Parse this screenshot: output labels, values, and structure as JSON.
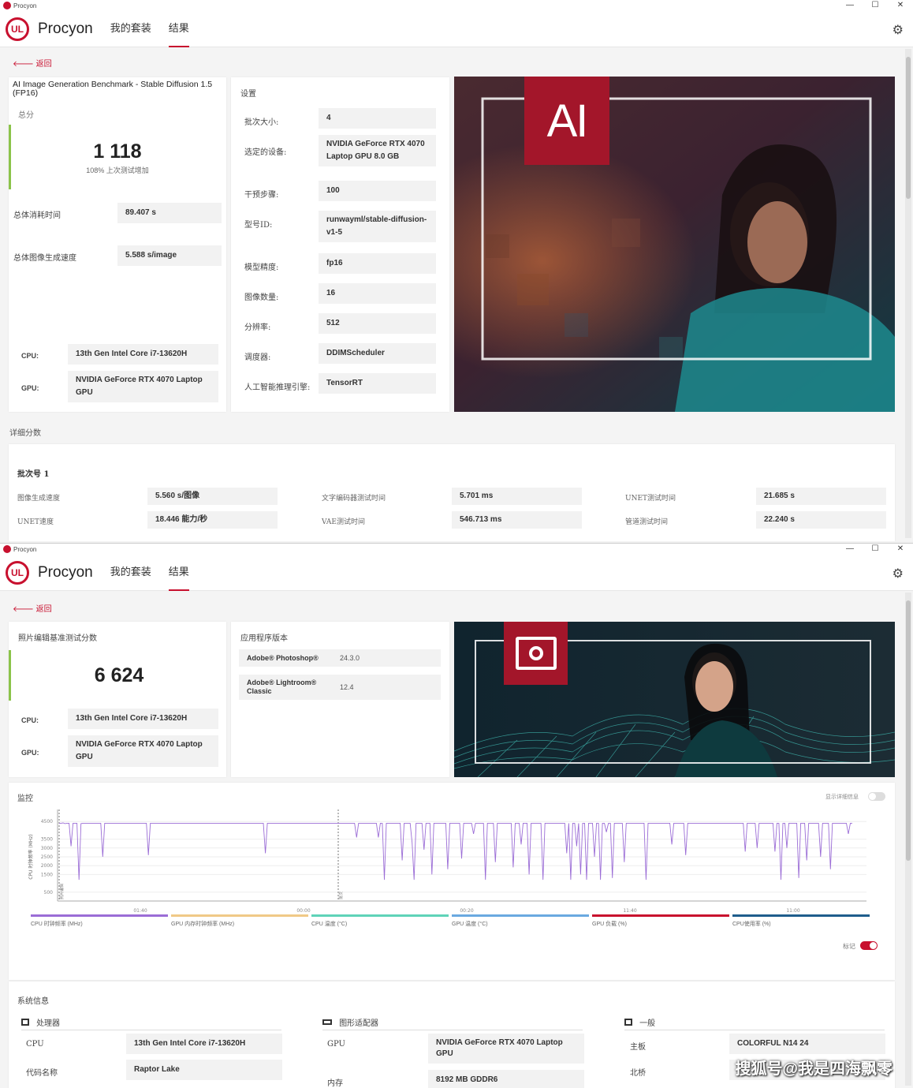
{
  "colors": {
    "brand": "#c8102e",
    "score_bar": "#8bc34a",
    "chart_line": "#9b6dd6"
  },
  "window1": {
    "title": "Procyon",
    "app_name": "Procyon",
    "logo": "UL",
    "tabs": [
      "我的套装",
      "结果"
    ],
    "back": "返回",
    "benchmark_title": "AI Image Generation Benchmark - Stable Diffusion 1.5 (FP16)",
    "score_label": "总分",
    "score": "1 118",
    "score_note": "108% 上次测试增加",
    "total_time_label": "总体消耗时间",
    "total_time": "89.407 s",
    "speed_label": "总体图像生成速度",
    "speed": "5.588 s/image",
    "cpu_label": "CPU:",
    "cpu": "13th Gen Intel Core i7-13620H",
    "gpu_label": "GPU:",
    "gpu": "NVIDIA GeForce RTX 4070 Laptop GPU",
    "settings_title": "设置",
    "settings": [
      {
        "label": "批次大小:",
        "value": "4"
      },
      {
        "label": "选定的设备:",
        "value": "NVIDIA GeForce RTX 4070 Laptop GPU 8.0 GB"
      },
      {
        "label": "干预步骤:",
        "value": "100"
      },
      {
        "label": "型号ID:",
        "value": "runwayml/stable-diffusion-v1-5"
      },
      {
        "label": "模型精度:",
        "value": "fp16"
      },
      {
        "label": "图像数量:",
        "value": "16"
      },
      {
        "label": "分辨率:",
        "value": "512"
      },
      {
        "label": "调度器:",
        "value": "DDIMScheduler"
      },
      {
        "label": "人工智能推理引擎:",
        "value": "TensorRT"
      }
    ],
    "hero_icon": "ai-logo-icon",
    "hero_logo_text": "AI",
    "detail_title": "详细分数",
    "batch_title": "批次号 1",
    "details": [
      {
        "label": "图像生成速度",
        "value": "5.560 s/图像"
      },
      {
        "label": "文字编码器测试时间",
        "value": "5.701 ms"
      },
      {
        "label": "UNET测试时间",
        "value": "21.685 s"
      },
      {
        "label": "UNET速度",
        "value": "18.446 能力/秒"
      },
      {
        "label": "VAE测试时间",
        "value": "546.713 ms"
      },
      {
        "label": "管道测试时间",
        "value": "22.240 s"
      }
    ]
  },
  "window2": {
    "title": "Procyon",
    "app_name": "Procyon",
    "logo": "UL",
    "tabs": [
      "我的套装",
      "结果"
    ],
    "back": "返回",
    "score_label": "照片编辑基准测试分数",
    "score": "6 624",
    "cpu_label": "CPU:",
    "cpu": "13th Gen Intel Core i7-13620H",
    "gpu_label": "GPU:",
    "gpu": "NVIDIA GeForce RTX 4070 Laptop GPU",
    "versions_title": "应用程序版本",
    "versions": [
      {
        "label": "Adobe® Photoshop®",
        "value": "24.3.0"
      },
      {
        "label": "Adobe® Lightroom® Classic",
        "value": "12.4"
      }
    ],
    "hero_icon": "photo-editing-icon",
    "monitor_title": "监控",
    "detail_toggle_label": "显示详细信息",
    "marker_label": "标记",
    "sysinfo_title": "系统信息",
    "sys_groups": [
      {
        "icon": "processor-icon",
        "title": "处理器",
        "rows": [
          {
            "label": "CPU",
            "value": "13th Gen Intel Core i7-13620H"
          },
          {
            "label": "代码名称",
            "value": "Raptor Lake"
          }
        ]
      },
      {
        "icon": "graphics-card-icon",
        "title": "图形适配器",
        "rows": [
          {
            "label": "GPU",
            "value": "NVIDIA GeForce RTX 4070 Laptop GPU"
          },
          {
            "label": "内存",
            "value": "8192 MB GDDR6"
          }
        ]
      },
      {
        "icon": "general-icon",
        "title": "一般",
        "rows": [
          {
            "label": "主板",
            "value": "COLORFUL N14 24"
          },
          {
            "label": "北桥",
            "value": ""
          }
        ]
      }
    ],
    "watermark": "搜狐号@我是四海飘零"
  },
  "chart_data": {
    "type": "line",
    "ylabel": "CPU 时钟频率 (MHz)",
    "y_ticks": [
      "4500",
      "3500",
      "3000",
      "2500",
      "2000",
      "1500",
      "500"
    ],
    "ylim": [
      0,
      5000
    ],
    "x_ticks": [
      "01:40",
      "00:00",
      "00:20",
      "11:40",
      "11:00"
    ],
    "markers": [
      "照片编辑",
      "批次"
    ],
    "series": [
      {
        "name": "CPU 时钟频率 (MHz)",
        "values": [
          4400,
          4400,
          4420,
          4380,
          4400,
          4400,
          3100,
          4400,
          4400,
          4400,
          1200,
          4380,
          4400,
          4400,
          4400,
          4400,
          4400,
          4400,
          4400,
          4400,
          4400,
          4400,
          2500,
          4400,
          4400,
          4400,
          4400,
          4400,
          4400,
          4400,
          4400,
          4400,
          4400,
          4400,
          4400,
          4400,
          4400,
          4400,
          4400,
          4400,
          4400,
          4400,
          4400,
          4400,
          4400,
          2600,
          4400,
          4400,
          4400,
          4400,
          4400,
          4400,
          4400,
          4400,
          4400,
          4400,
          4400,
          4400,
          4400,
          4400,
          4400,
          4400,
          4400,
          4400,
          4400,
          4400,
          4400,
          4400,
          4400,
          4400,
          4400,
          4400,
          4400,
          4400,
          4400,
          4400,
          4400,
          4400,
          4400,
          4400,
          4400,
          4400,
          4400,
          4400,
          4400,
          4400,
          4400,
          4400,
          4400,
          4400,
          4400,
          4400,
          4400,
          4400,
          4400,
          4400,
          4400,
          4400,
          4400,
          4400,
          4400,
          4400,
          4400,
          4400,
          2700,
          4400,
          4400,
          4400,
          4400,
          4400,
          4400,
          4400,
          4400,
          4400,
          4400,
          4400,
          4400,
          4400,
          4400,
          4400,
          4400,
          4400,
          4400,
          4400,
          4400,
          4400,
          4400,
          4400,
          4400,
          4400,
          4400,
          4400,
          4400,
          4400,
          4400,
          4400,
          4400,
          4400,
          4400,
          4400,
          4400,
          4400,
          4400,
          4400,
          4400,
          4400,
          4400,
          4400,
          4400,
          4400,
          3600,
          4400,
          4400,
          4400,
          4400,
          4400,
          4400,
          4400,
          4400,
          4400,
          4400,
          3600,
          4400,
          4400,
          1200,
          4400,
          4400,
          4400,
          4400,
          4400,
          4400,
          4400,
          4400,
          2300,
          4400,
          4400,
          4400,
          4400,
          3300,
          1200,
          4400,
          4400,
          4400,
          4400,
          2900,
          4400,
          4400,
          4400,
          1500,
          4400,
          4400,
          4400,
          4400,
          4400,
          4400,
          4400,
          1800,
          4400,
          4400,
          4400,
          4400,
          4400,
          4400,
          2400,
          4400,
          4400,
          4400,
          4400,
          4400,
          3800,
          4400,
          4400,
          4400,
          4400,
          4400,
          1200,
          4400,
          4400,
          4400,
          4400,
          2200,
          4400,
          4400,
          4400,
          4400,
          4400,
          4400,
          4400,
          4400,
          1900,
          4400,
          4400,
          4400,
          3200,
          4400,
          4400,
          4400,
          1500,
          4400,
          4400,
          4400,
          4400,
          4400,
          4400,
          1200,
          4400,
          4400,
          4400,
          4400,
          4400,
          4400,
          4400,
          4400,
          4400,
          4400,
          4400,
          2700,
          4400,
          1200,
          4400,
          4400,
          3100,
          4400,
          1500,
          4400,
          4400,
          1200,
          4400,
          4400,
          4400,
          2500,
          4400,
          4400,
          1200,
          4400,
          4400,
          3900,
          4400,
          4400,
          1300,
          4400,
          4400,
          4400,
          4400,
          4400,
          2200,
          4400,
          4400,
          4400,
          4400,
          4400,
          4400,
          4400,
          4400,
          4400,
          4400,
          1200,
          4400,
          4400,
          4400,
          4400,
          4400,
          4400,
          4400,
          4400,
          4400,
          4400,
          4400,
          4400,
          3200,
          4400,
          4400,
          4400,
          4400,
          4400,
          4400,
          2600,
          4400,
          4400,
          4400,
          4400,
          4400,
          4400,
          4400,
          4400,
          4400,
          4400,
          4400,
          4400,
          4400,
          4400,
          4400,
          4400,
          4400,
          4400,
          4400,
          4400,
          4400,
          4400,
          4400,
          4400,
          4400,
          4400,
          4400,
          4400,
          4400,
          2800,
          4400,
          4400,
          4400,
          4400,
          4400,
          3000,
          4400,
          4400,
          4400,
          4400,
          4400,
          4400,
          4400,
          4400,
          2800,
          4400,
          4400,
          1200,
          4400,
          4400,
          3000,
          4400,
          4400,
          4400,
          4400,
          4400,
          1300,
          4400,
          4400,
          4400,
          2300,
          4400,
          4400,
          4400,
          4400,
          4400,
          4400,
          2500,
          4400,
          4400,
          4400,
          4400,
          1800,
          4400,
          4400,
          4400,
          4400,
          4400,
          4400,
          4400,
          4400,
          3800,
          4400,
          4400
        ]
      }
    ],
    "legend": [
      {
        "name": "CPU 时钟频率 (MHz)",
        "color": "#9b6dd6"
      },
      {
        "name": "GPU 内存时钟频率 (MHz)",
        "color": "#f0c987"
      },
      {
        "name": "CPU 温度 (°C)",
        "color": "#5fd3b8"
      },
      {
        "name": "GPU 温度 (°C)",
        "color": "#6aa9e0"
      },
      {
        "name": "GPU 负载 (%)",
        "color": "#c8102e"
      },
      {
        "name": "CPU使用率 (%)",
        "color": "#1f5d8c"
      }
    ]
  }
}
